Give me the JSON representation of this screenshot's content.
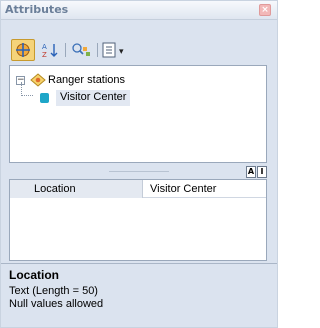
{
  "window": {
    "title": "Attributes",
    "close_glyph": "×"
  },
  "toolbar": {
    "icons": [
      "layer-view-icon",
      "sort-icon",
      "flash-icon",
      "options-icon"
    ],
    "dropdown_glyph": "▾"
  },
  "tree": {
    "layer": {
      "label": "Ranger stations",
      "expander": "−",
      "icon": "point-layer-icon"
    },
    "feature": {
      "label": "Visitor Center",
      "icon": "feature-icon"
    }
  },
  "view_toggle": {
    "left": "A",
    "right": "I"
  },
  "grid": {
    "rows": [
      {
        "name": "Location",
        "value": "Visitor Center"
      }
    ]
  },
  "description": {
    "title": "Location",
    "line1": "Text (Length = 50)",
    "line2": "Null values allowed"
  },
  "colors": {
    "accent": "#f5d37a",
    "feature_icon": "#1ea6c8",
    "panel_bg": "#dbe3ef"
  }
}
